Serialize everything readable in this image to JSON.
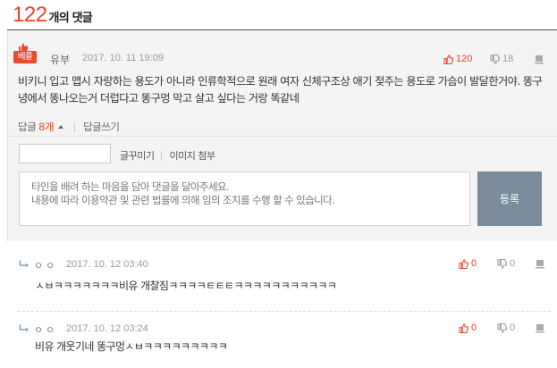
{
  "header": {
    "count": "122",
    "label": "개의 댓글"
  },
  "best": {
    "badge_label": "베플",
    "author": "유부",
    "date": "2017. 10. 11 19:09",
    "likes": "120",
    "dislikes": "18",
    "body": "비키니 입고 맵시 자랑하는 용도가 아니라 인류학적으로 원래 여자 신체구조상 애기 젖주는 용도로 가슴이 발달한거야. 똥구녕에서 똥나오는거 더럽다고 똥구멍 막고 살고 싶다는 거랑 똑같네"
  },
  "reply_bar": {
    "reply_label": "답글",
    "reply_count": "8개",
    "write_reply": "답글쓰기"
  },
  "form": {
    "name_value": "",
    "tool_emoticon": "글꾸미기",
    "tool_image": "이미지 첨부",
    "placeholder_line1": "타인을 배려 하는 마음을 담아 댓글을 달아주세요.",
    "placeholder_line2": "내용에 따라 이용약관 및 관련 법률에 의해 임의 조치를 수행 할 수 있습니다.",
    "submit_label": "등록"
  },
  "replies": [
    {
      "author": "ㅇㅇ",
      "date": "2017. 10. 12 03:40",
      "likes": "0",
      "dislikes": "0",
      "text": "ㅅㅂㅋㅋㅋㅋㅋㅋㅋ비유 개찰짐ㅋㅋㅋㅋㅌㅌㅌㅋㅋㅋㅋㅋㅋㅋㅋㅋㅋㅋ"
    },
    {
      "author": "ㅇㅇ",
      "date": "2017. 10. 12 03:24",
      "likes": "0",
      "dislikes": "0",
      "text": "비유 개웃기네 똥구멍ㅅㅂㅋㅋㅋㅋㅋㅋㅋㅋㅋ"
    }
  ],
  "icons": {
    "thumb_up": "thumbs-up-icon",
    "thumb_down": "thumbs-down-icon",
    "report": "report-flag-icon",
    "reply_arrow": "reply-arrow-icon"
  },
  "colors": {
    "accent": "#e8452c",
    "submit_bg": "#7a8c9b",
    "panel_bg": "#f4f4f4"
  }
}
